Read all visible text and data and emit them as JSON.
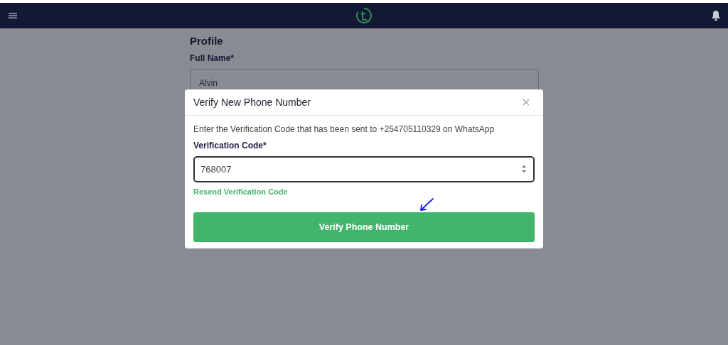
{
  "profile": {
    "title": "Profile",
    "fields": [
      {
        "label": "Full Name*",
        "value": "Alvin"
      }
    ]
  },
  "modal": {
    "title": "Verify New Phone Number",
    "message": "Enter the Verification Code that has been sent to +254705110329 on WhatsApp",
    "field": {
      "label": "Verification Code*",
      "value": "768007"
    },
    "resend_link": "Resend Verification Code",
    "submit_button": "Verify Phone Number"
  }
}
